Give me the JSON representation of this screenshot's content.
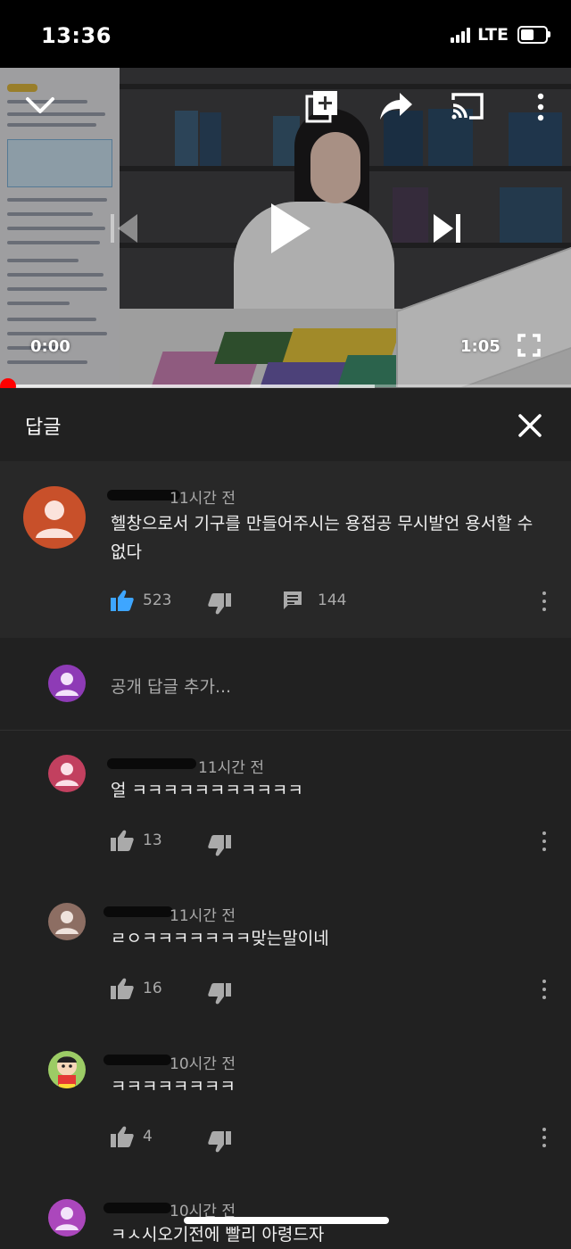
{
  "status_bar": {
    "time": "13:36",
    "network": "LTE",
    "icons": [
      "signal-icon",
      "battery-icon"
    ]
  },
  "player": {
    "current_time": "0:00",
    "duration": "1:05",
    "progress": 0.0,
    "buffered": 0.65,
    "icons": [
      "chevron-down-icon",
      "add-to-playlist-icon",
      "share-icon",
      "cast-icon",
      "more-icon",
      "previous-icon",
      "play-icon",
      "next-icon",
      "fullscreen-icon"
    ]
  },
  "replies_sheet": {
    "title": "답글",
    "close_icon": "close-icon"
  },
  "parent_comment": {
    "time": "11시간 전",
    "text_line1": "헬창으로서 기구를 만들어주시는 용접공 무시발언 용서할 수",
    "text_line2": "없다",
    "likes": "523",
    "replies": "144",
    "avatar_color": "#c8502a"
  },
  "add_reply": {
    "placeholder": "공개 답글 추가...",
    "avatar_color": "#8e3bb6"
  },
  "replies": [
    {
      "time": "11시간 전",
      "text": "얼 ㅋㅋㅋㅋㅋㅋㅋㅋㅋㅋㅋ",
      "likes": "13",
      "avatar_color": "#c2405f"
    },
    {
      "time": "11시간 전",
      "text": "ㄹㅇㅋㅋㅋㅋㅋㅋㅋ맞는말이네",
      "likes": "16",
      "avatar_color": "#8d6e63"
    },
    {
      "time": "10시간 전",
      "text": "ㅋㅋㅋㅋㅋㅋㅋㅋ",
      "likes": "4",
      "avatar_color": "#7cb342"
    },
    {
      "time": "10시간 전",
      "text": "ㅋㅅ시오기전에 빨리 아령드자",
      "likes": "",
      "avatar_color": "#ab47bc"
    }
  ],
  "colors": {
    "background": "#212121",
    "highlight_bg": "#282828",
    "like_active": "#3ea6ff",
    "progress": "#ff0000",
    "secondary_text": "#aaaaaa"
  }
}
